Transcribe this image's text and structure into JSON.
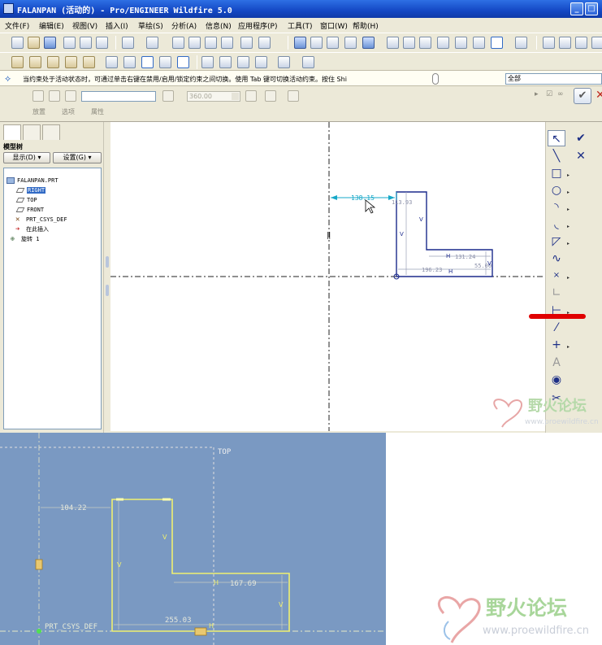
{
  "window": {
    "title": "FALANPAN (活动的) - Pro/ENGINEER Wildfire 5.0",
    "min_label": "_",
    "max_label": "□"
  },
  "menu": [
    "文件(F)",
    "编辑(E)",
    "视图(V)",
    "插入(I)",
    "草绘(S)",
    "分析(A)",
    "信息(N)",
    "应用程序(P)",
    "工具(T)",
    "窗口(W)",
    "帮助(H)"
  ],
  "message": {
    "text": "当约束处于活动状态时，可通过单击右键在禁用/启用/锁定约束之间切换。使用 Tab 键可切换活动约束。按住 Shi",
    "filter_value": "全部"
  },
  "dashboard": {
    "angle_value": "360.00",
    "tabs": [
      "放置",
      "选项",
      "属性"
    ]
  },
  "model_tree": {
    "title": "模型树",
    "show_button": "显示(D) ▾",
    "settings_button": "设置(G) ▾",
    "items": [
      {
        "label": "FALANPAN.PRT",
        "selected": false
      },
      {
        "label": "RIGHT",
        "selected": true
      },
      {
        "label": "TOP",
        "selected": false
      },
      {
        "label": "FRONT",
        "selected": false
      },
      {
        "label": "PRT_CSYS_DEF",
        "selected": false
      },
      {
        "label": "在此插入",
        "selected": false
      },
      {
        "label": "旋转 1",
        "selected": false
      }
    ]
  },
  "sketch_top": {
    "dimensions": [
      "138.15",
      "113.93",
      "131.24",
      "196.23",
      "55.00"
    ],
    "constraint_marks": [
      "V",
      "V",
      "H",
      "H",
      "V"
    ]
  },
  "sketch_bottom": {
    "datum_label": "TOP",
    "csys_label": "PRT_CSYS_DEF",
    "dimensions": [
      "104.22",
      "167.69",
      "255.03"
    ],
    "constraint_marks": [
      "V",
      "V",
      "H",
      "V",
      "H"
    ]
  },
  "watermark": {
    "title": "野火论坛",
    "url": "www.proewildfire.cn"
  },
  "colors": {
    "titlebar": "#1448c4",
    "selection": "#316ac5",
    "sketch_line": "#1b2a8c",
    "dimension": "#16a8c8",
    "bottom_bg": "#7a99c2",
    "bottom_sketch": "#f0f070",
    "highlight_mark": "#e00000"
  }
}
